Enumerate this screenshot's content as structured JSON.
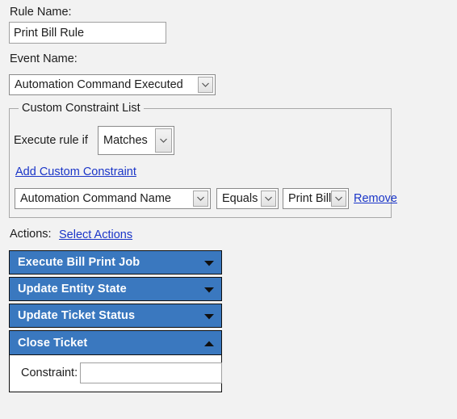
{
  "form": {
    "rule_name": {
      "label": "Rule Name:",
      "value": "Print Bill Rule",
      "placeholder": ""
    },
    "event_name": {
      "label": "Event Name:",
      "selected": "Automation Command Executed"
    }
  },
  "custom_constraint_list": {
    "legend": "Custom Constraint List",
    "execute_rule_if_label": "Execute rule if",
    "match_mode_selected": "Matches",
    "add_link": "Add Custom Constraint",
    "constraints": [
      {
        "field_selected": "Automation Command Name",
        "operator_selected": "Equals",
        "value_selected": "Print Bill",
        "remove_link": "Remove"
      }
    ]
  },
  "actions": {
    "label": "Actions:",
    "select_link": "Select Actions",
    "items": [
      {
        "title": "Execute Bill Print Job",
        "expanded": false,
        "arrow_icon": "chevron-down-icon"
      },
      {
        "title": "Update Entity State",
        "expanded": false,
        "arrow_icon": "chevron-down-icon"
      },
      {
        "title": "Update Ticket Status",
        "expanded": false,
        "arrow_icon": "chevron-down-icon"
      },
      {
        "title": "Close Ticket",
        "expanded": true,
        "arrow_icon": "chevron-up-icon",
        "body": {
          "constraint_label": "Constraint:",
          "constraint_value": "",
          "constraint_placeholder": ""
        }
      }
    ]
  },
  "colors": {
    "page_background": "#f2f2f2",
    "accordion_header": "#3a78bf",
    "accordion_header_text": "#ffffff",
    "link": "#1a35c8",
    "text": "#1d1d1d",
    "input_background": "#ffffff",
    "input_border": "#a0a0a0",
    "fieldset_border": "#a8a8a8"
  }
}
